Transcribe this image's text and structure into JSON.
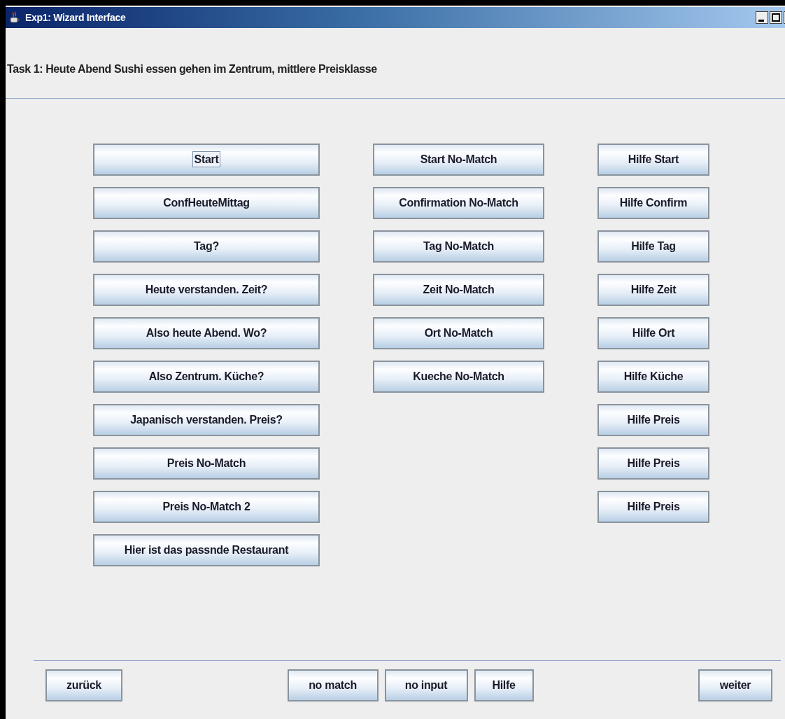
{
  "window": {
    "title": "Exp1: Wizard Interface"
  },
  "task": "Task 1: Heute Abend Sushi essen gehen im Zentrum, mittlere Preisklasse",
  "columns": [
    {
      "buttons": [
        {
          "label": "Start",
          "focused": true
        },
        {
          "label": "ConfHeuteMittag",
          "focused": false
        },
        {
          "label": "Tag?",
          "focused": false
        },
        {
          "label": "Heute verstanden. Zeit?",
          "focused": false
        },
        {
          "label": "Also heute Abend. Wo?",
          "focused": false
        },
        {
          "label": "Also Zentrum. Küche?",
          "focused": false
        },
        {
          "label": "Japanisch verstanden. Preis?",
          "focused": false
        },
        {
          "label": "Preis No-Match",
          "focused": false
        },
        {
          "label": "Preis No-Match 2",
          "focused": false
        },
        {
          "label": "Hier ist das passnde Restaurant",
          "focused": false
        }
      ]
    },
    {
      "buttons": [
        {
          "label": "Start No-Match",
          "focused": false
        },
        {
          "label": "Confirmation No-Match",
          "focused": false
        },
        {
          "label": "Tag No-Match",
          "focused": false
        },
        {
          "label": "Zeit No-Match",
          "focused": false
        },
        {
          "label": "Ort No-Match",
          "focused": false
        },
        {
          "label": "Kueche No-Match",
          "focused": false
        }
      ]
    },
    {
      "buttons": [
        {
          "label": "Hilfe Start",
          "focused": false
        },
        {
          "label": "Hilfe Confirm",
          "focused": false
        },
        {
          "label": "Hilfe Tag",
          "focused": false
        },
        {
          "label": "Hilfe Zeit",
          "focused": false
        },
        {
          "label": "Hilfe Ort",
          "focused": false
        },
        {
          "label": "Hilfe Küche",
          "focused": false
        },
        {
          "label": "Hilfe Preis",
          "focused": false
        },
        {
          "label": "Hilfe Preis",
          "focused": false
        },
        {
          "label": "Hilfe Preis",
          "focused": false
        }
      ]
    }
  ],
  "bottom_buttons": [
    {
      "label": "zurück",
      "kind": "left"
    },
    {
      "label": "no match",
      "kind": "center"
    },
    {
      "label": "no input",
      "kind": "center"
    },
    {
      "label": "Hilfe",
      "kind": "center"
    },
    {
      "label": "weiter",
      "kind": "right"
    }
  ]
}
